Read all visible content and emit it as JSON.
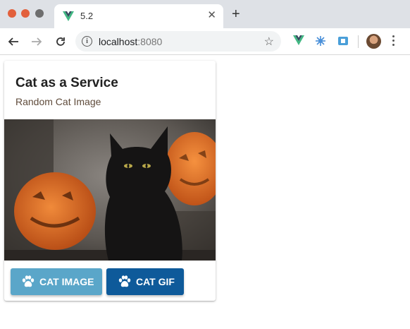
{
  "browser": {
    "tab": {
      "title": "5.2",
      "favicon": "vue-logo-icon"
    },
    "url": {
      "host": "localhost",
      "port": ":8080"
    },
    "extensions": [
      "vue-devtools-icon",
      "bug-extension-icon",
      "box-extension-icon"
    ]
  },
  "card": {
    "title": "Cat as a Service",
    "subtitle": "Random Cat Image",
    "image": {
      "description_icon": "cat-photo"
    },
    "buttons": {
      "image_label": "CAT IMAGE",
      "gif_label": "CAT GIF"
    }
  },
  "colors": {
    "primary_light": "#5aa6c9",
    "primary_dark": "#0e5a9a",
    "pumpkin": "#e56b1f"
  }
}
